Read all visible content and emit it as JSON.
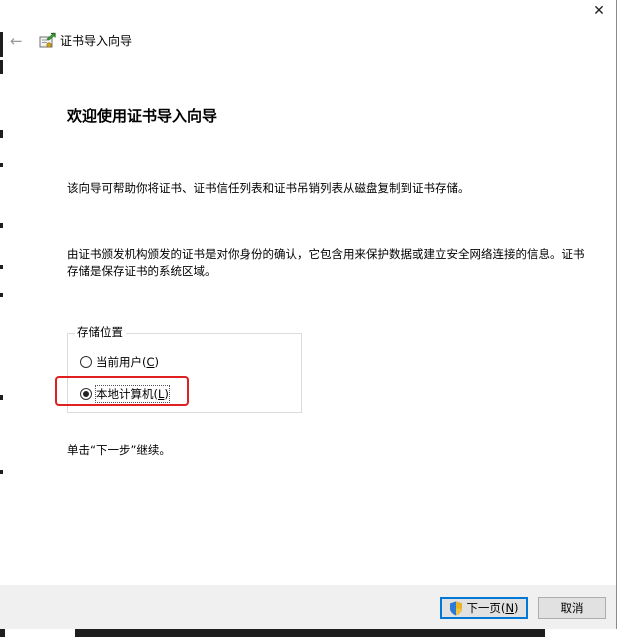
{
  "window": {
    "title": "证书导入向导",
    "close_glyph": "✕",
    "back_glyph": "←"
  },
  "content": {
    "heading": "欢迎使用证书导入向导",
    "para1": "该向导可帮助你将证书、证书信任列表和证书吊销列表从磁盘复制到证书存储。",
    "para2": "由证书颁发机构颁发的证书是对你身份的确认，它包含用来保护数据或建立安全网络连接的信息。证书存储是保存证书的系统区域。",
    "store_location": {
      "legend": "存储位置",
      "options": [
        {
          "label": "当前用户(",
          "key": "C",
          "suffix": ")",
          "selected": false
        },
        {
          "label": "本地计算机(",
          "key": "L",
          "suffix": ")",
          "selected": true
        }
      ]
    },
    "continue_text": "单击“下一步”继续。"
  },
  "footer": {
    "next": {
      "label": "下一页(",
      "key": "N",
      "suffix": ")"
    },
    "cancel": "取消"
  },
  "colors": {
    "highlight": "#e02020",
    "default_button_border": "#0078d7",
    "footer_bg": "#f0f0f0"
  },
  "icons": [
    "back-arrow-icon",
    "certificate-wizard-icon",
    "close-icon",
    "uac-shield-icon",
    "radio-button"
  ]
}
